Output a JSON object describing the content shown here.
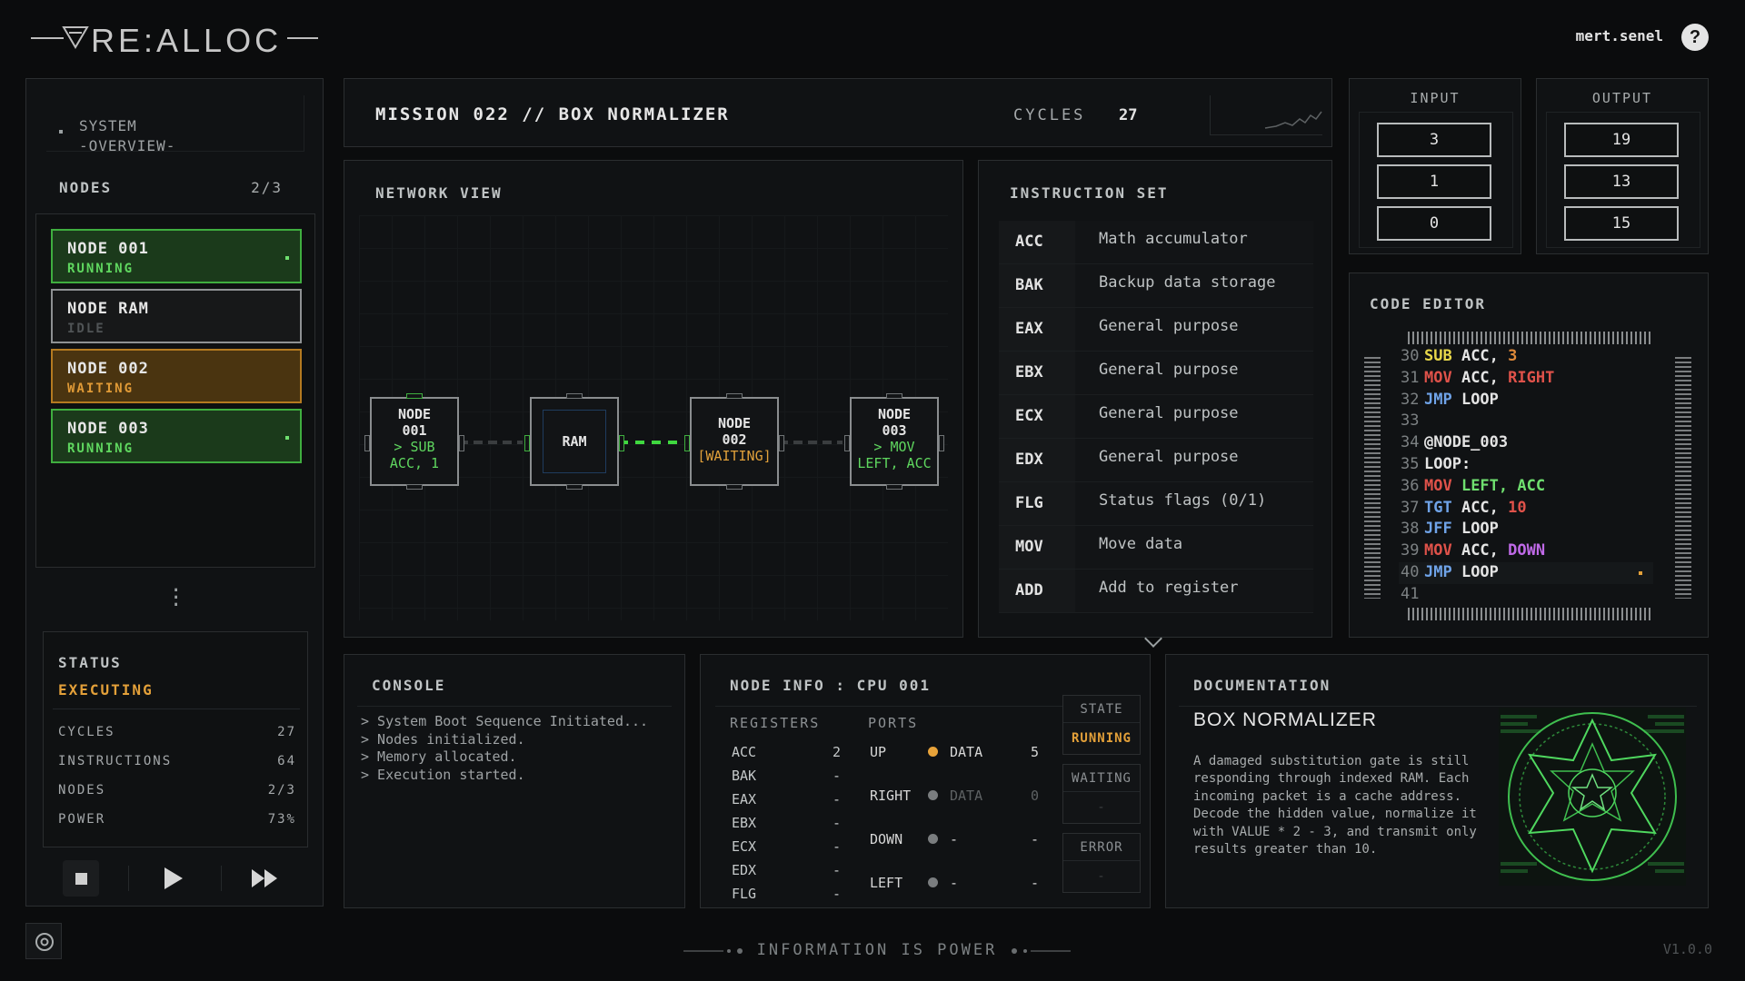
{
  "app": {
    "logo": "RE:ALLOC",
    "user": "mert.senel",
    "help": "?"
  },
  "sidebar": {
    "system_title": "SYSTEM",
    "system_sub": "-OVERVIEW-",
    "nodes_label": "NODES",
    "nodes_count": "2/3",
    "nodes": [
      {
        "name": "NODE 001",
        "state": "RUNNING"
      },
      {
        "name": "NODE RAM",
        "state": "IDLE"
      },
      {
        "name": "NODE 002",
        "state": "WAITING"
      },
      {
        "name": "NODE 003",
        "state": "RUNNING"
      }
    ],
    "status_label": "STATUS",
    "status_value": "EXECUTING",
    "stats": [
      {
        "label": "CYCLES",
        "value": "27"
      },
      {
        "label": "INSTRUCTIONS",
        "value": "64"
      },
      {
        "label": "NODES",
        "value": "2/3"
      },
      {
        "label": "POWER",
        "value": "73%"
      }
    ]
  },
  "mission": {
    "title": "MISSION 022 // BOX NORMALIZER",
    "cycles_label": "CYCLES",
    "cycles_value": "27"
  },
  "network": {
    "title": "NETWORK VIEW",
    "nodes": [
      {
        "line1": "NODE",
        "line2": "001",
        "line3": "> SUB",
        "line4": "ACC, 1"
      },
      {
        "line1": "RAM"
      },
      {
        "line1": "NODE",
        "line2": "002",
        "line3": "[WAITING]"
      },
      {
        "line1": "NODE",
        "line2": "003",
        "line3": "> MOV",
        "line4": "LEFT, ACC"
      }
    ]
  },
  "instructions": {
    "title": "INSTRUCTION SET",
    "rows": [
      {
        "key": "ACC",
        "desc": "Math accumulator"
      },
      {
        "key": "BAK",
        "desc": "Backup data storage"
      },
      {
        "key": "EAX",
        "desc": "General purpose"
      },
      {
        "key": "EBX",
        "desc": "General purpose"
      },
      {
        "key": "ECX",
        "desc": "General purpose"
      },
      {
        "key": "EDX",
        "desc": "General purpose"
      },
      {
        "key": "FLG",
        "desc": "Status flags (0/1)"
      },
      {
        "key": "MOV",
        "desc": "Move data"
      },
      {
        "key": "ADD",
        "desc": "Add to register"
      }
    ]
  },
  "io": {
    "input_label": "INPUT",
    "input": [
      "3",
      "1",
      "0"
    ],
    "output_label": "OUTPUT",
    "output": [
      "19",
      "13",
      "15"
    ]
  },
  "editor": {
    "title": "CODE EDITOR",
    "lines": [
      {
        "n": "30",
        "a": "SUB",
        "b": " ACC, ",
        "c": "3"
      },
      {
        "n": "31",
        "a": "MOV",
        "b": " ACC, ",
        "c": "RIGHT"
      },
      {
        "n": "32",
        "a": "JMP",
        "b": " LOOP",
        "c": ""
      },
      {
        "n": "33",
        "a": "",
        "b": "",
        "c": ""
      },
      {
        "n": "34",
        "a": "",
        "b": "@NODE_003",
        "c": ""
      },
      {
        "n": "35",
        "a": "",
        "b": "LOOP:",
        "c": ""
      },
      {
        "n": "36",
        "a": "MOV",
        "b": " LEFT, ",
        "c": "ACC"
      },
      {
        "n": "37",
        "a": "TGT",
        "b": " ACC, ",
        "c": "10"
      },
      {
        "n": "38",
        "a": "JFF",
        "b": " LOOP",
        "c": ""
      },
      {
        "n": "39",
        "a": "MOV",
        "b": " ACC, ",
        "c": "DOWN"
      },
      {
        "n": "40",
        "a": "JMP",
        "b": " LOOP",
        "c": ""
      },
      {
        "n": "41",
        "a": "",
        "b": "",
        "c": ""
      }
    ]
  },
  "console": {
    "title": "CONSOLE",
    "lines": [
      "> System Boot Sequence Initiated...",
      "> Nodes initialized.",
      "> Memory allocated.",
      "> Execution started."
    ]
  },
  "nodeinfo": {
    "title": "NODE INFO : CPU 001",
    "registers_label": "REGISTERS",
    "ports_label": "PORTS",
    "registers": [
      {
        "k": "ACC",
        "v": "2"
      },
      {
        "k": "BAK",
        "v": "-"
      },
      {
        "k": "EAX",
        "v": "-"
      },
      {
        "k": "EBX",
        "v": "-"
      },
      {
        "k": "ECX",
        "v": "-"
      },
      {
        "k": "EDX",
        "v": "-"
      },
      {
        "k": "FLG",
        "v": "-"
      }
    ],
    "ports": [
      {
        "k": "UP",
        "l": "DATA",
        "v": "5"
      },
      {
        "k": "RIGHT",
        "l": "DATA",
        "v": "0"
      },
      {
        "k": "DOWN",
        "l": "-",
        "v": "-"
      },
      {
        "k": "LEFT",
        "l": "-",
        "v": "-"
      }
    ],
    "states": [
      {
        "h": "STATE",
        "b": "RUNNING"
      },
      {
        "h": "WAITING",
        "b": "-"
      },
      {
        "h": "ERROR",
        "b": "-"
      }
    ]
  },
  "docs": {
    "title": "DOCUMENTATION",
    "heading": "BOX NORMALIZER",
    "body": "A damaged substitution gate is still responding through indexed RAM. Each incoming packet is a cache address. Decode the hidden value, normalize it with VALUE * 2 - 3, and transmit only results greater than 10."
  },
  "footer": {
    "tagline": "INFORMATION IS POWER",
    "version": "V1.0.0"
  },
  "colors": {
    "running": "#5fd75f",
    "waiting": "#e09a36",
    "accent_port": "#e8a33a"
  }
}
